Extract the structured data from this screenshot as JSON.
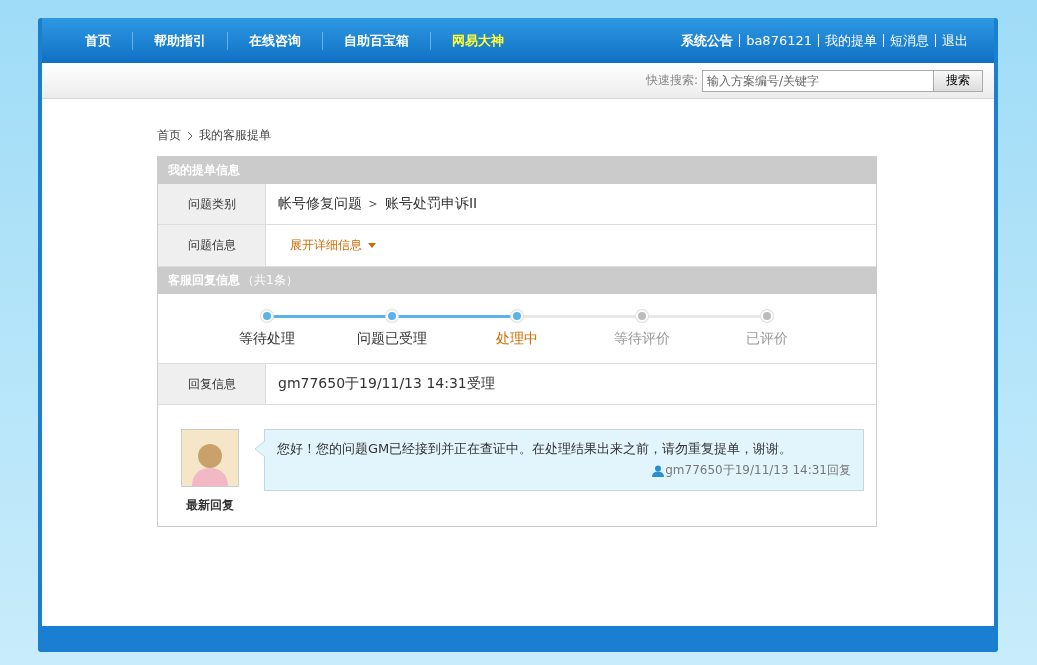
{
  "nav": {
    "items": [
      {
        "label": "首页",
        "highlight": false
      },
      {
        "label": "帮助指引",
        "highlight": false
      },
      {
        "label": "在线咨询",
        "highlight": false
      },
      {
        "label": "自助百宝箱",
        "highlight": false
      },
      {
        "label": "网易大神",
        "highlight": true
      }
    ],
    "user_links": [
      {
        "label": "系统公告",
        "bold": true
      },
      {
        "label": "ba876121",
        "bold": false
      },
      {
        "label": "我的提单",
        "bold": false
      },
      {
        "label": "短消息",
        "bold": false
      },
      {
        "label": "退出",
        "bold": false
      }
    ]
  },
  "search": {
    "label": "快速搜索:",
    "placeholder": "输入方案编号/关键字",
    "button": "搜索"
  },
  "breadcrumb": [
    "首页",
    "我的客服提单"
  ],
  "ticket": {
    "title": "我的提单信息",
    "rows": [
      {
        "kind": "text",
        "label": "问题类别",
        "value": "帐号修复问题 ＞ 账号处罚申诉II"
      },
      {
        "kind": "toggle",
        "label": "问题信息",
        "value": "展开详细信息",
        "expanded": false
      }
    ]
  },
  "replies": {
    "title": "客服回复信息",
    "count": "（共1条）",
    "steps": [
      {
        "label": "等待处理",
        "reached": true,
        "selected": false
      },
      {
        "label": "问题已受理",
        "reached": true,
        "selected": false
      },
      {
        "label": "处理中",
        "reached": true,
        "selected": true
      },
      {
        "label": "等待评价",
        "reached": false,
        "selected": false
      },
      {
        "label": "已评价",
        "reached": false,
        "selected": false
      }
    ],
    "info": {
      "label": "回复信息",
      "value": "gm77650于19/11/13 14:31受理"
    },
    "latest": {
      "caption": "最新回复",
      "message": "您好！您的问题GM已经接到并正在查证中。在处理结果出来之前，请勿重复提单，谢谢。",
      "meta": "gm77650于19/11/13 14:31回复"
    }
  }
}
